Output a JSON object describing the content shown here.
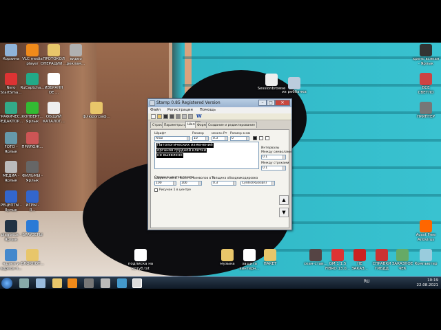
{
  "desktop_left_icons": [
    {
      "label": "Корзина",
      "icon": "recycle-bin-icon",
      "color": "#8fb3d9"
    },
    {
      "label": "VLC media\nplayer",
      "icon": "vlc-icon",
      "color": "#f08a1a"
    },
    {
      "label": "ПРОТОКОЛ\nОПЕРАЦИИ ...",
      "icon": "folder-icon",
      "color": "#e8c66a"
    },
    {
      "label": "видео\nреклам...",
      "icon": "folder-icon",
      "color": "#b0b0b0"
    },
    {
      "label": "Nero\nStartSma...",
      "icon": "nero-icon",
      "color": "#d33"
    },
    {
      "label": "RuCaptcha...",
      "icon": "rucaptcha-icon",
      "color": "#2a8"
    },
    {
      "label": "ИЗБРАНН\nОЕ ...",
      "icon": "document-icon",
      "color": "#fff"
    },
    {
      "label": "ГРАФИЧЕС...\nРЕДАКТОР...",
      "icon": "paint-icon",
      "color": "#3a8"
    },
    {
      "label": "КОНВЕРТ...\nЯрлык",
      "icon": "converter-icon",
      "color": "#3b3"
    },
    {
      "label": "ОБЩИЙ\nКАТАЛОГ...",
      "icon": "document-icon",
      "color": "#eee"
    },
    {
      "label": "флюрограф...",
      "icon": "folder-icon",
      "color": "#e8c66a"
    },
    {
      "label": "FOTO -\nЯрлык",
      "icon": "photo-icon",
      "color": "#69a"
    },
    {
      "label": "ПРИЛОЖ...",
      "icon": "app-icon",
      "color": "#c55"
    },
    {
      "label": "МЕДИА -\nЯрлык",
      "icon": "disc-icon",
      "color": "#bbb"
    },
    {
      "label": "ФИЛЬМЫ -\nЯрлык",
      "icon": "film-icon",
      "color": "#666"
    },
    {
      "label": "РЕЦЕПТЫ -\nЯрлык",
      "icon": "help-icon",
      "color": "#36c"
    },
    {
      "label": "ИГРЫ -\nЯ...",
      "icon": "info-icon",
      "color": "#36c"
    },
    {
      "label": "plagiatus -\nЯрлык",
      "icon": "text-icon",
      "color": "#234"
    },
    {
      "label": "БРАУЗЕРЫ",
      "icon": "globe-icon",
      "color": "#2a7ad6"
    },
    {
      "label": "ящики и\nадреса п...",
      "icon": "mail-icon",
      "color": "#48c"
    },
    {
      "label": "БЛОКНОТ...",
      "icon": "folder-icon",
      "color": "#e8c66a"
    }
  ],
  "desktop_right_icons": [
    {
      "label": "хрень всякая\n- Ярлык",
      "icon": "monitor-icon",
      "color": "#333"
    },
    {
      "label": "ВСЕ\nСВЕТЛО",
      "icon": "person-icon",
      "color": "#c44"
    },
    {
      "label": "ПРИНТЕР",
      "icon": "printer-icon",
      "color": "#777"
    },
    {
      "label": "Avast Free\nAntivirus",
      "icon": "avast-icon",
      "color": "#f60"
    },
    {
      "label": "Компьютер",
      "icon": "computer-icon",
      "color": "#9cd"
    }
  ],
  "desktop_middle_icons": [
    {
      "label": "Sessionbrowse",
      "icon": "document-icon",
      "color": "#eee"
    },
    {
      "label": "из реббанка",
      "icon": "laptop-icon",
      "color": "#bcd"
    },
    {
      "label": "подписка на\nкотуб.txt",
      "icon": "document-icon",
      "color": "#fff"
    },
    {
      "label": "музыка",
      "icon": "folder-icon",
      "color": "#e8c66a"
    },
    {
      "label": "защита\nвинтерн...",
      "icon": "document-icon",
      "color": "#fff"
    },
    {
      "label": "ПАКЕТ",
      "icon": "folder-icon",
      "color": "#e8c66a"
    },
    {
      "label": "скан-стаи...",
      "icon": "scanner-icon",
      "color": "#544"
    },
    {
      "label": "GM 1 1.5\nFIBRO 13.0...",
      "icon": "app-icon",
      "color": "#d33"
    },
    {
      "label": "НЕ\nЗАКАЗ...",
      "icon": "no-icon",
      "color": "#c22"
    },
    {
      "label": "СПРАВКИ\nГИБДД",
      "icon": "app-icon",
      "color": "#c33"
    },
    {
      "label": "ЗАКАЗНОЕ\nЧЕК",
      "icon": "check-icon",
      "color": "#6a6"
    }
  ],
  "window": {
    "title": "Stamp 0.85 Registered Version",
    "menu": [
      "Файл",
      "Регистрация",
      "Помощь"
    ],
    "tabs": [
      "Строка",
      "Параметры строк",
      "Шапка",
      "Форма",
      "Создание и редактирование"
    ],
    "active_tab": 2,
    "font_label": "Шрифт",
    "font_value": "Arial",
    "size_label": "Размер",
    "size_value": "10",
    "spacing_label": "межзн.Рт",
    "spacing_value": "0.3",
    "frame_label": "Размер в мм",
    "frame_value": "0",
    "lines_label": "Строка в центре печати",
    "text_lines": [
      "Патологических изменений",
      "органов грудной клетки",
      "не выявлено"
    ],
    "intervals_label": "Интервалы",
    "between_chars_label": "Между символами",
    "between_chars_value": "0.1",
    "between_lines_label": "Между строками",
    "between_lines_value": "0.1",
    "char_width_label": "Ширина симв.",
    "char_width_value": "100",
    "char_height_label": "Высота символов в %",
    "char_height_value": "100",
    "outline_label": "Толщина обводки",
    "outline_value": "0.3",
    "encoding_label": "кодировка",
    "encoding_value": "Cyrillic(Russian)",
    "center_pic_label": "Рисунок 1 в центре"
  },
  "tray": {
    "lang": "RU",
    "time": "10:19",
    "date": "22.08.2021"
  }
}
